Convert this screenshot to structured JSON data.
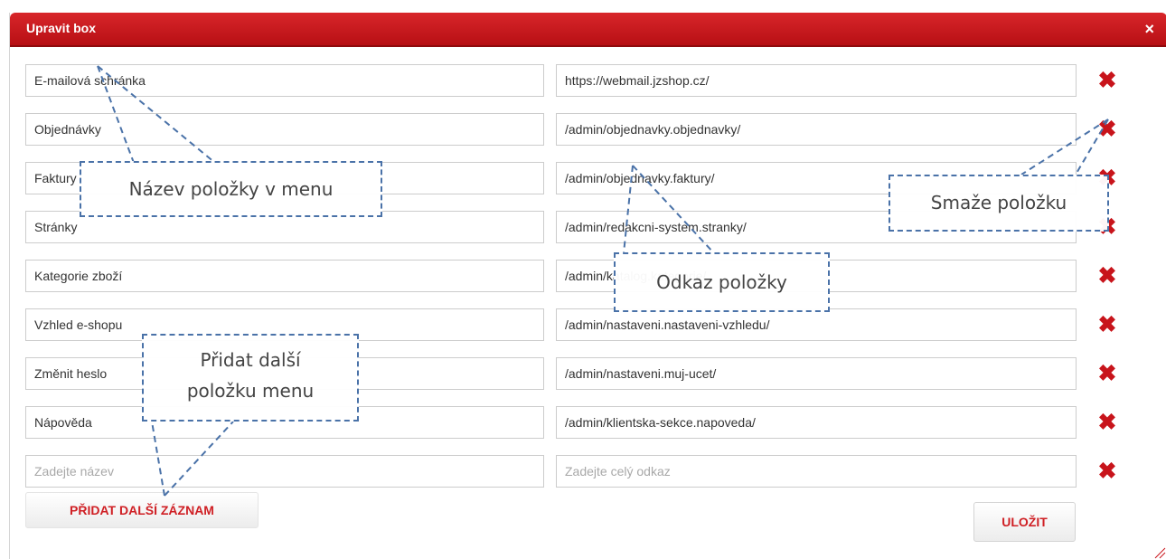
{
  "dialog": {
    "title": "Upravit box",
    "close_label": "×"
  },
  "rows": [
    {
      "name": "E-mailová schránka",
      "link": "https://webmail.jzshop.cz/"
    },
    {
      "name": "Objednávky",
      "link": "/admin/objednavky.objednavky/"
    },
    {
      "name": "Faktury",
      "link": "/admin/objednavky.faktury/"
    },
    {
      "name": "Stránky",
      "link": "/admin/redakcni-system.stranky/"
    },
    {
      "name": "Kategorie zboží",
      "link": "/admin/katalog.kategorie/"
    },
    {
      "name": "Vzhled e-shopu",
      "link": "/admin/nastaveni.nastaveni-vzhledu/"
    },
    {
      "name": "Změnit heslo",
      "link": "/admin/nastaveni.muj-ucet/"
    },
    {
      "name": "Nápověda",
      "link": "/admin/klientska-sekce.napoveda/"
    }
  ],
  "new_row": {
    "name_placeholder": "Zadejte název",
    "link_placeholder": "Zadejte celý odkaz"
  },
  "delete_icon": "delete-x-icon",
  "buttons": {
    "add": "PŘIDAT DALŠÍ ZÁZNAM",
    "save": "ULOŽIT"
  },
  "callouts": {
    "name": "Název položky v menu",
    "link": "Odkaz položky",
    "delete": "Smaže položku",
    "add_line1": "Přidat další",
    "add_line2": "položku menu"
  },
  "colors": {
    "titlebar": "#c8141b",
    "delete_icon": "#c8141b",
    "button_text": "#cf1f24",
    "callout_border": "#4a72a8"
  }
}
